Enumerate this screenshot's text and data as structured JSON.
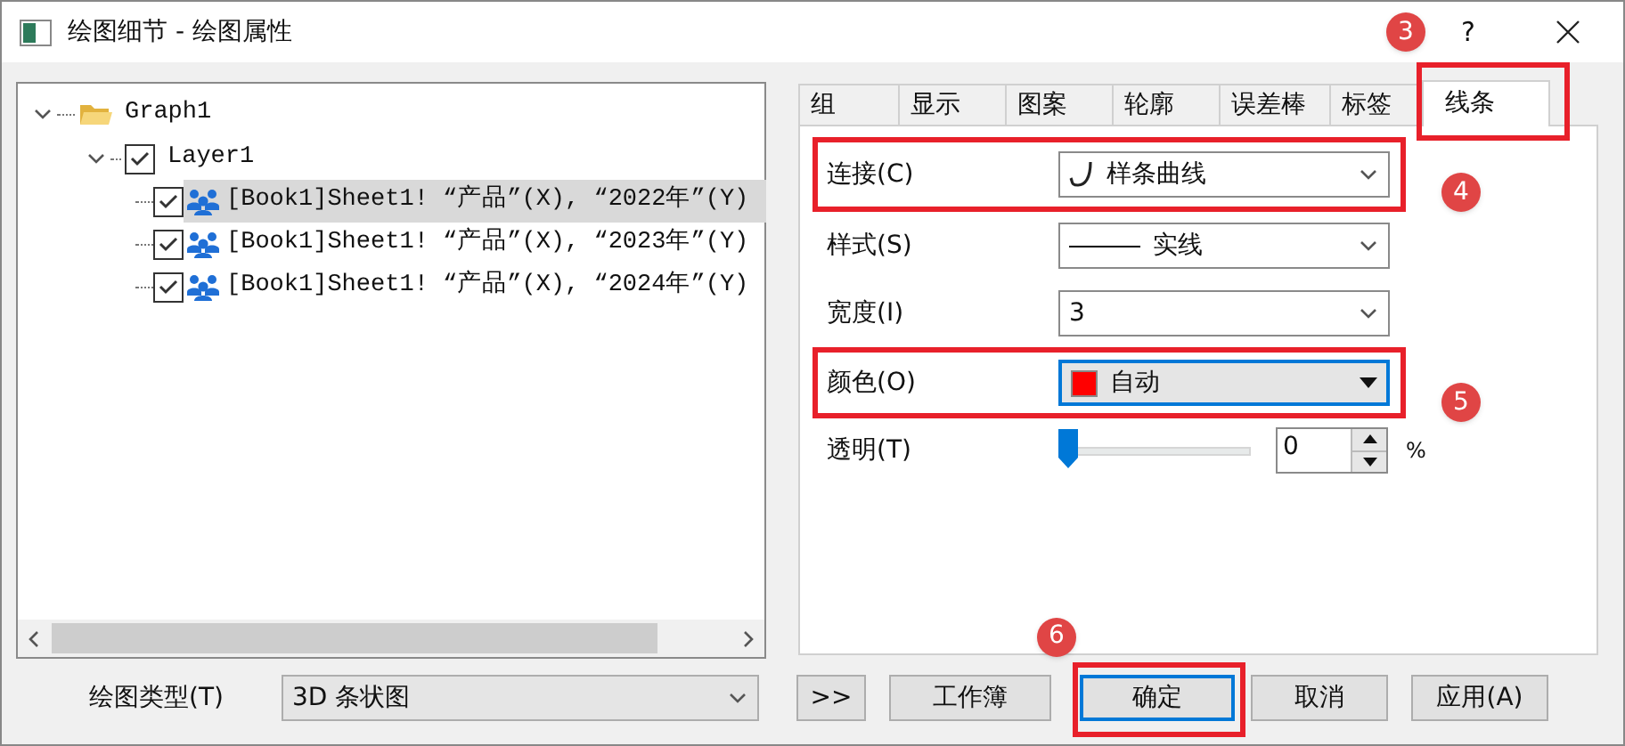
{
  "window": {
    "title": "绘图细节 - 绘图属性",
    "help": "?"
  },
  "tree": {
    "label": "Graph1",
    "expanded": true,
    "children": [
      {
        "label": "Layer1",
        "expanded": true,
        "checked": true,
        "children": [
          {
            "label": "[Book1]Sheet1! “产品”(X), “2022年”(Y)",
            "checked": true,
            "selected": true
          },
          {
            "label": "[Book1]Sheet1! “产品”(X), “2023年”(Y)",
            "checked": true,
            "selected": false
          },
          {
            "label": "[Book1]Sheet1! “产品”(X), “2024年”(Y)",
            "checked": true,
            "selected": false
          }
        ]
      }
    ]
  },
  "tabs": [
    {
      "label": "组",
      "selected": false
    },
    {
      "label": "显示",
      "selected": false
    },
    {
      "label": "图案",
      "selected": false
    },
    {
      "label": "轮廓",
      "selected": false
    },
    {
      "label": "误差棒",
      "selected": false
    },
    {
      "label": "标签",
      "selected": false
    },
    {
      "label": "线条",
      "selected": true,
      "badge": "3"
    }
  ],
  "rows": [
    {
      "kind": "dropdown",
      "label": "连接(C)",
      "value": "样条曲线",
      "focused": false,
      "badge": "4"
    },
    {
      "kind": "dropdown",
      "label": "样式(S)",
      "value": "实线",
      "focused": false
    },
    {
      "kind": "dropdown",
      "label": "宽度(I)",
      "value": "3",
      "focused": false
    },
    {
      "kind": "dropdown",
      "label": "颜色(O)",
      "value": "自动",
      "focused": true,
      "badge": "5"
    },
    {
      "kind": "slider",
      "label": "透明(T)",
      "level": 0,
      "value": "0",
      "unit": "%"
    }
  ],
  "footer": {
    "label": "绘图类型(T)",
    "value": "3D 条状图"
  },
  "buttons": [
    {
      "label": ">>",
      "default": false
    },
    {
      "label": "工作簿",
      "default": false
    },
    {
      "label": "确定",
      "default": true,
      "badge": "6"
    },
    {
      "label": "取消",
      "default": false
    },
    {
      "label": "应用(A)",
      "default": false
    }
  ]
}
